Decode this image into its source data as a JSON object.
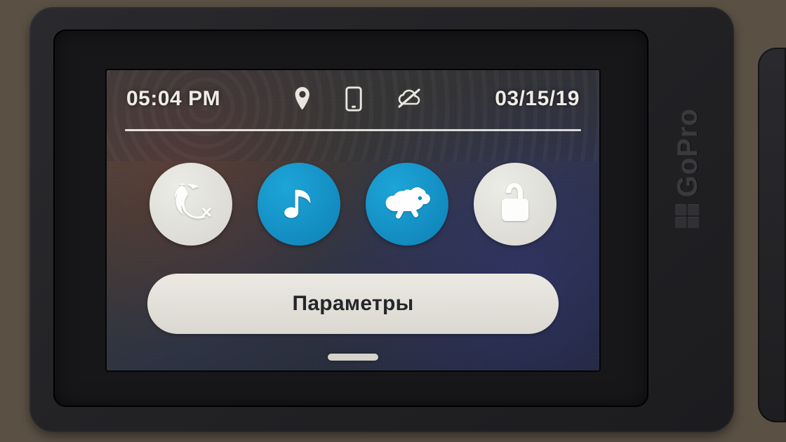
{
  "brand": "GoPro",
  "statusbar": {
    "time": "05:04 PM",
    "date": "03/15/19",
    "icons": {
      "gps": "gps-icon",
      "phone": "phone-icon",
      "cloud_sync_off": "cloud-off-icon"
    }
  },
  "toggles": [
    {
      "name": "voice-control-off",
      "state": "off",
      "icon": "voice-mute-icon"
    },
    {
      "name": "beeps-on",
      "state": "on",
      "icon": "music-note-icon"
    },
    {
      "name": "quikcapture-on",
      "state": "on",
      "icon": "rabbit-icon"
    },
    {
      "name": "lock-unlocked",
      "state": "off",
      "icon": "unlock-icon"
    }
  ],
  "preferences_button": {
    "label": "Параметры"
  },
  "colors": {
    "accent_on": "#0f8fc6",
    "pill_bg": "#e4e2da",
    "text_light": "#efeee8"
  }
}
